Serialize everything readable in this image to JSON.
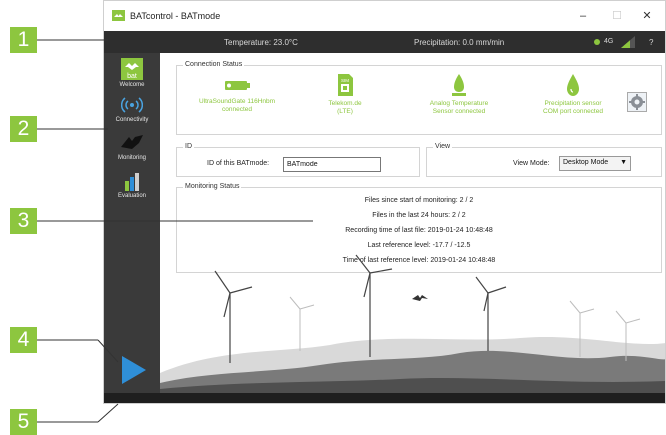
{
  "window": {
    "title": "BATcontrol - BATmode",
    "controls": {
      "minimize": "–",
      "maximize": "☐",
      "close": "✕"
    }
  },
  "statusbar": {
    "temperature": "Temperature: 23.0°C",
    "precipitation": "Precipitation: 0.0 mm/min",
    "network": "4G",
    "help": "?"
  },
  "sidebar": {
    "items": [
      {
        "label": "Welcome",
        "icon": "bat-logo-icon",
        "active": true
      },
      {
        "label": "Connectivity",
        "icon": "connectivity-icon",
        "active": false
      },
      {
        "label": "Monitoring",
        "icon": "bat-icon",
        "active": false
      },
      {
        "label": "Evaluation",
        "icon": "bar-chart-icon",
        "active": false
      }
    ],
    "logo_text": "bat"
  },
  "connection_status": {
    "title": "Connection Status",
    "items": [
      {
        "line1": "UltraSoundGate 116Hnbm",
        "line2": "connected",
        "icon": "ultrasound-device-icon"
      },
      {
        "line1": "Telekom.de",
        "line2": "(LTE)",
        "icon": "sim-card-icon",
        "sim_text": "SIM"
      },
      {
        "line1": "Analog Temperature",
        "line2": "Sensor connected",
        "icon": "thermometer-icon"
      },
      {
        "line1": "Precipitation sensor",
        "line2": "COM port connected",
        "icon": "raindrop-icon"
      }
    ]
  },
  "id_panel": {
    "title": "ID",
    "label": "ID of this BATmode:",
    "value": "BATmode"
  },
  "view_panel": {
    "title": "View",
    "label": "View Mode:",
    "selected": "Desktop Mode"
  },
  "monitoring_status": {
    "title": "Monitoring Status",
    "lines": [
      "Files since start of monitoring: 2 / 2",
      "Files in the last 24 hours: 2 / 2",
      "Recording time of last file: 2019-01-24 10:48:48",
      "Last reference level: -17.7 / -12.5",
      "Time of last reference level: 2019-01-24 10:48:48"
    ]
  },
  "callouts": [
    "1",
    "2",
    "3",
    "4",
    "5"
  ],
  "colors": {
    "accent": "#8dc63f",
    "dark": "#2e2e2e",
    "play": "#2f8fd8"
  }
}
